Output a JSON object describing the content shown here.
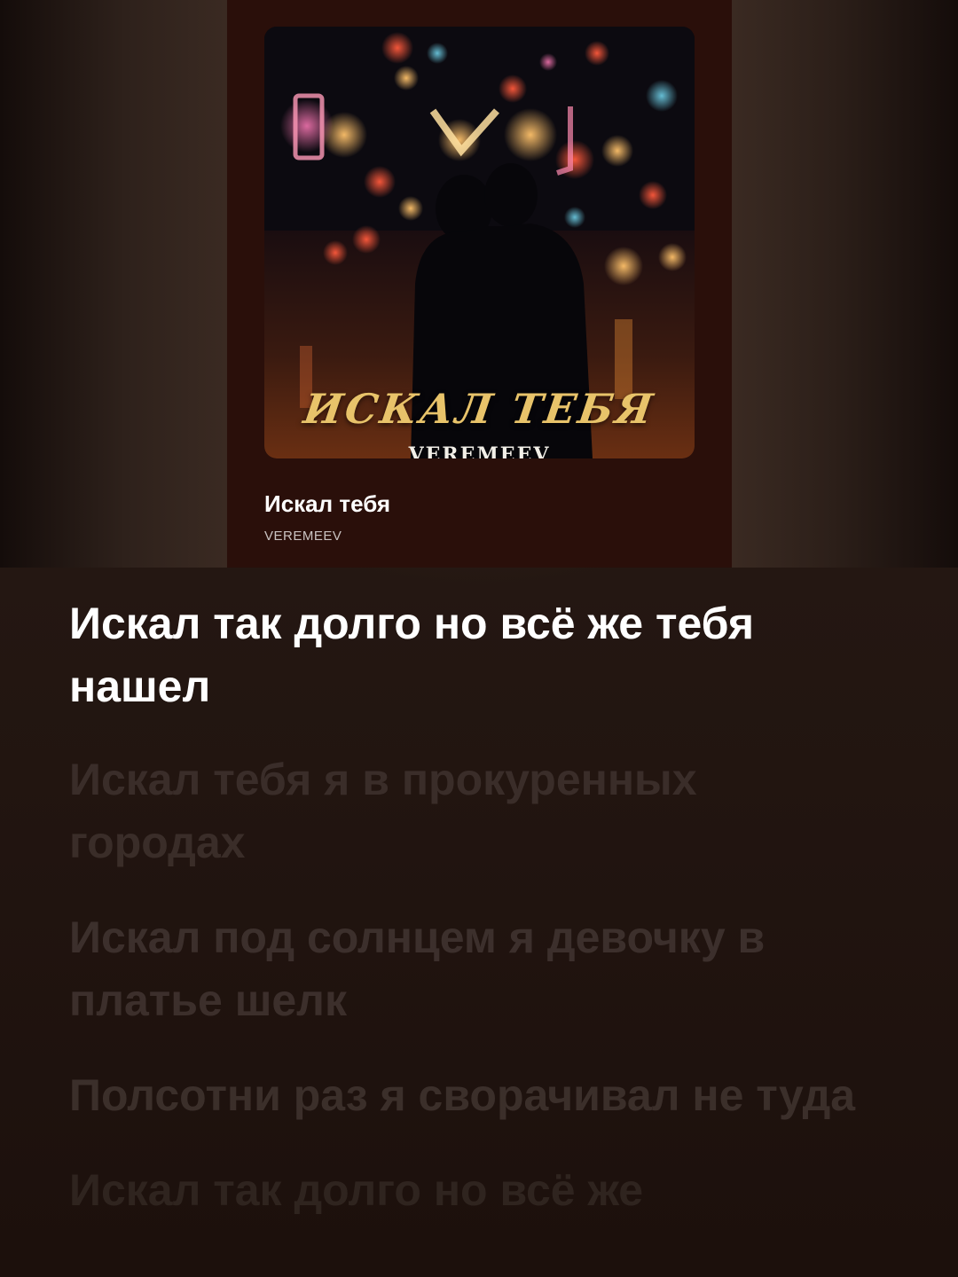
{
  "now_playing": {
    "cover": {
      "title_text": "ИСКАЛ ТЕБЯ",
      "artist_text": "VEREMEEV"
    },
    "track_title": "Искал тебя",
    "artist": "VEREMEEV"
  },
  "lyrics": [
    "Искал так долго но всё же тебя нашел",
    "Искал тебя я в прокуренных городах",
    "Искал под солнцем я девочку в платье шелк",
    "Полсотни раз я сворачивал не туда",
    "Искал так долго но всё же"
  ],
  "colors": {
    "background": "#241712",
    "card": "#2a0f0a",
    "active_lyric": "#ffffff",
    "cover_title": "#e8c36a"
  }
}
